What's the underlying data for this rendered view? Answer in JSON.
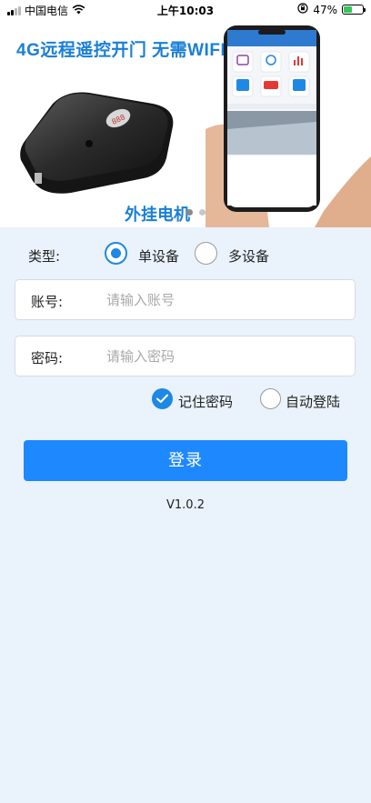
{
  "status_bar": {
    "carrier": "中国电信",
    "time": "上午10:03",
    "battery_percent": "47%",
    "battery_level": 0.47,
    "icons": [
      "signal-icon",
      "wifi-icon",
      "orientation-lock-icon",
      "battery-icon"
    ]
  },
  "banner": {
    "headline": "4G远程遥控开门 无需WIFI",
    "caption": "外挂电机",
    "device_label": "888",
    "carousel_active": 0,
    "carousel_count": 2
  },
  "form": {
    "type_label": "类型:",
    "type_options": [
      {
        "label": "单设备",
        "selected": true
      },
      {
        "label": "多设备",
        "selected": false
      }
    ],
    "account": {
      "label": "账号:",
      "placeholder": "请输入账号",
      "value": ""
    },
    "password": {
      "label": "密码:",
      "placeholder": "请输入密码",
      "value": ""
    },
    "remember_password": {
      "label": "记住密码",
      "checked": true
    },
    "auto_login": {
      "label": "自动登陆",
      "checked": false
    },
    "login_button": "登录"
  },
  "version": "V1.0.2",
  "colors": {
    "accent": "#1e88ff",
    "headline": "#1a7fd6",
    "page_bg": "#eaf2fb"
  }
}
